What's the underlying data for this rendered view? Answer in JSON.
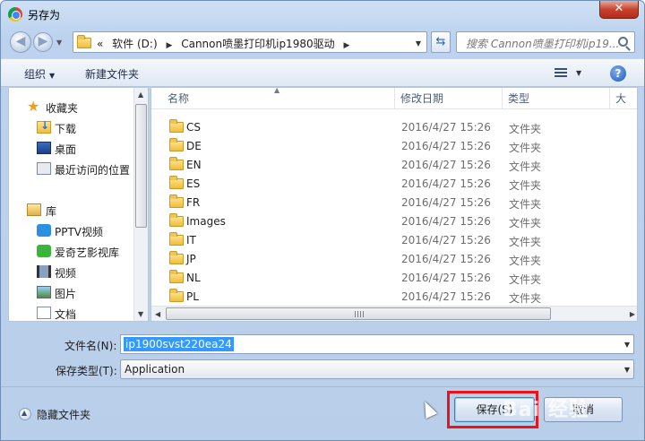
{
  "window": {
    "title": "另存为",
    "close_glyph": "✕"
  },
  "nav": {
    "back_glyph": "◀",
    "forward_glyph": "▶",
    "address": {
      "prefix": "«",
      "segments": [
        "软件 (D:)",
        "Cannon喷墨打印机ip1980驱动"
      ],
      "sep": "▶"
    },
    "search_placeholder": "搜索 Cannon喷墨打印机ip19..."
  },
  "toolbar": {
    "organize": "组织",
    "new_folder": "新建文件夹",
    "help": "?"
  },
  "sidebar": {
    "favorites": "收藏夹",
    "favorite_items": [
      "下载",
      "桌面",
      "最近访问的位置"
    ],
    "libraries": "库",
    "library_items": [
      "PPTV视频",
      "爱奇艺影视库",
      "视频",
      "图片",
      "文档"
    ]
  },
  "columns": {
    "name": "名称",
    "date": "修改日期",
    "type": "类型",
    "size": "大"
  },
  "files": [
    {
      "name": "CS",
      "date": "2016/4/27 15:26",
      "type": "文件夹"
    },
    {
      "name": "DE",
      "date": "2016/4/27 15:26",
      "type": "文件夹"
    },
    {
      "name": "EN",
      "date": "2016/4/27 15:26",
      "type": "文件夹"
    },
    {
      "name": "ES",
      "date": "2016/4/27 15:26",
      "type": "文件夹"
    },
    {
      "name": "FR",
      "date": "2016/4/27 15:26",
      "type": "文件夹"
    },
    {
      "name": "Images",
      "date": "2016/4/27 15:26",
      "type": "文件夹"
    },
    {
      "name": "IT",
      "date": "2016/4/27 15:26",
      "type": "文件夹"
    },
    {
      "name": "JP",
      "date": "2016/4/27 15:26",
      "type": "文件夹"
    },
    {
      "name": "NL",
      "date": "2016/4/27 15:26",
      "type": "文件夹"
    },
    {
      "name": "PL",
      "date": "2016/4/27 15:26",
      "type": "文件夹"
    }
  ],
  "form": {
    "filename_label": "文件名(N):",
    "filename_value": "ip1900svst220ea24",
    "filetype_label": "保存类型(T):",
    "filetype_value": "Application"
  },
  "footer": {
    "hide_folders": "隐藏文件夹",
    "save": "保存(S)",
    "cancel": "取消"
  },
  "watermark": "Bai 经验",
  "colors": {
    "highlight": "#e8141a",
    "selection": "#3399ff"
  }
}
